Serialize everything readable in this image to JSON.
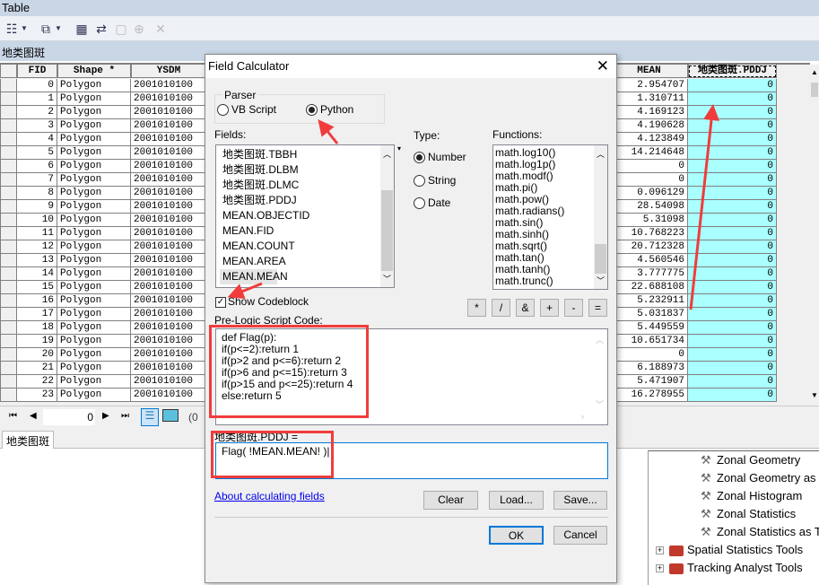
{
  "window": {
    "title": "Table",
    "table_name": "地类图斑",
    "tab": "地类图斑"
  },
  "toolbar": {
    "icons": [
      "table-options-icon",
      "related-tables-icon",
      "select-by-attributes-icon",
      "switch-selection-icon",
      "clear-selection-icon",
      "zoom-to-selected-icon",
      "delete-selected-icon"
    ]
  },
  "table": {
    "columns": [
      "FID",
      "Shape *",
      "YSDM",
      "MEAN",
      "地类图斑.PDDJ"
    ],
    "rows": [
      {
        "fid": "0",
        "shape": "Polygon",
        "ysdm": "2001010100",
        "mean": "2.954707",
        "pddj": "0"
      },
      {
        "fid": "1",
        "shape": "Polygon",
        "ysdm": "2001010100",
        "mean": "1.310711",
        "pddj": "0"
      },
      {
        "fid": "2",
        "shape": "Polygon",
        "ysdm": "2001010100",
        "mean": "4.169123",
        "pddj": "0"
      },
      {
        "fid": "3",
        "shape": "Polygon",
        "ysdm": "2001010100",
        "mean": "4.190628",
        "pddj": "0"
      },
      {
        "fid": "4",
        "shape": "Polygon",
        "ysdm": "2001010100",
        "mean": "4.123849",
        "pddj": "0"
      },
      {
        "fid": "5",
        "shape": "Polygon",
        "ysdm": "2001010100",
        "mean": "14.214648",
        "pddj": "0"
      },
      {
        "fid": "6",
        "shape": "Polygon",
        "ysdm": "2001010100",
        "mean": "0",
        "pddj": "0"
      },
      {
        "fid": "7",
        "shape": "Polygon",
        "ysdm": "2001010100",
        "mean": "0",
        "pddj": "0"
      },
      {
        "fid": "8",
        "shape": "Polygon",
        "ysdm": "2001010100",
        "mean": "0.096129",
        "pddj": "0"
      },
      {
        "fid": "9",
        "shape": "Polygon",
        "ysdm": "2001010100",
        "mean": "28.54098",
        "pddj": "0"
      },
      {
        "fid": "10",
        "shape": "Polygon",
        "ysdm": "2001010100",
        "mean": "5.31098",
        "pddj": "0"
      },
      {
        "fid": "11",
        "shape": "Polygon",
        "ysdm": "2001010100",
        "mean": "10.768223",
        "pddj": "0"
      },
      {
        "fid": "12",
        "shape": "Polygon",
        "ysdm": "2001010100",
        "mean": "20.712328",
        "pddj": "0"
      },
      {
        "fid": "13",
        "shape": "Polygon",
        "ysdm": "2001010100",
        "mean": "4.560546",
        "pddj": "0"
      },
      {
        "fid": "14",
        "shape": "Polygon",
        "ysdm": "2001010100",
        "mean": "3.777775",
        "pddj": "0"
      },
      {
        "fid": "15",
        "shape": "Polygon",
        "ysdm": "2001010100",
        "mean": "22.688108",
        "pddj": "0"
      },
      {
        "fid": "16",
        "shape": "Polygon",
        "ysdm": "2001010100",
        "mean": "5.232911",
        "pddj": "0"
      },
      {
        "fid": "17",
        "shape": "Polygon",
        "ysdm": "2001010100",
        "mean": "5.031837",
        "pddj": "0"
      },
      {
        "fid": "18",
        "shape": "Polygon",
        "ysdm": "2001010100",
        "mean": "5.449559",
        "pddj": "0"
      },
      {
        "fid": "19",
        "shape": "Polygon",
        "ysdm": "2001010100",
        "mean": "10.651734",
        "pddj": "0"
      },
      {
        "fid": "20",
        "shape": "Polygon",
        "ysdm": "2001010100",
        "mean": "0",
        "pddj": "0"
      },
      {
        "fid": "21",
        "shape": "Polygon",
        "ysdm": "2001010100",
        "mean": "6.188973",
        "pddj": "0"
      },
      {
        "fid": "22",
        "shape": "Polygon",
        "ysdm": "2001010100",
        "mean": "5.471907",
        "pddj": "0"
      },
      {
        "fid": "23",
        "shape": "Polygon",
        "ysdm": "2001010100",
        "mean": "16.278955",
        "pddj": "0"
      }
    ],
    "highlight_color": "#aaffff"
  },
  "nav": {
    "record": "0",
    "selected_text": "(0"
  },
  "tree": {
    "tools": [
      "Zonal Geometry",
      "Zonal Geometry as",
      "Zonal Histogram",
      "Zonal Statistics",
      "Zonal Statistics as T"
    ],
    "toolboxes": [
      "Spatial Statistics Tools",
      "Tracking Analyst Tools"
    ]
  },
  "dialog": {
    "title": "Field Calculator",
    "parser_label": "Parser",
    "parser_options": [
      "VB Script",
      "Python"
    ],
    "parser_selected": "Python",
    "fields_label": "Fields:",
    "fields": [
      "地类图斑.TBBH",
      "地类图斑.DLBM",
      "地类图斑.DLMC",
      "地类图斑.PDDJ",
      "MEAN.OBJECTID",
      "MEAN.FID",
      "MEAN.COUNT",
      "MEAN.AREA",
      "MEAN.MEAN"
    ],
    "type_label": "Type:",
    "types": [
      "Number",
      "String",
      "Date"
    ],
    "type_selected": "Number",
    "functions_label": "Functions:",
    "functions": [
      "math.log10()",
      "math.log1p()",
      "math.modf()",
      "math.pi()",
      "math.pow()",
      "math.radians()",
      "math.sin()",
      "math.sinh()",
      "math.sqrt()",
      "math.tan()",
      "math.tanh()",
      "math.trunc()"
    ],
    "show_codeblock": "Show Codeblock",
    "show_codeblock_checked": true,
    "operators": [
      "*",
      "/",
      "&",
      "+",
      "-",
      "="
    ],
    "prelogic_label": "Pre-Logic Script Code:",
    "prelogic_code": "def Flag(p):\nif(p<=2):return 1\nif(p>2 and p<=6):return 2\nif(p>6 and p<=15):return 3\nif(p>15 and p<=25):return 4\nelse:return 5",
    "expression_label": "地类图斑.PDDJ =",
    "expression": "Flag( !MEAN.MEAN! )",
    "help_link": "About calculating fields",
    "clear": "Clear",
    "load": "Load...",
    "save": "Save...",
    "ok": "OK",
    "cancel": "Cancel"
  },
  "annotation_color": "#f03c3c"
}
